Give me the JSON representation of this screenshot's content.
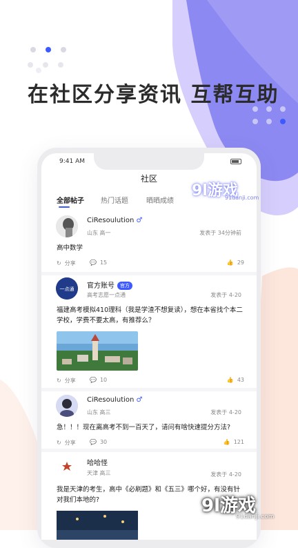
{
  "colors": {
    "accent": "#3d5afe",
    "blob_purple": "#8c89f2",
    "blob_lavender": "#cfc6fb",
    "blob_peach": "#fde6db"
  },
  "headline": "在社区分享资讯 互帮互助",
  "phone": {
    "status_time": "9:41 AM",
    "title": "社区",
    "tabs": [
      "全部帖子",
      "热门话题",
      "晒晒成绩"
    ],
    "posts": [
      {
        "name": "CiResoulution",
        "gender_icon": "male-icon",
        "meta": "山东 高一",
        "time": "发表于 34分钟前",
        "content": "高中数学",
        "share": "分享",
        "comments": "15",
        "likes": "29"
      },
      {
        "name": "官方账号",
        "badge": "官方",
        "avatar_text": "一点通",
        "meta": "高考志愿一点通",
        "time": "发表于 4-20",
        "content": "福建高考模拟410理科（我是学渣不想复读），想在本省找个本二学校，学费不要太高，有推荐么？",
        "share": "分享",
        "comments": "10",
        "likes": "43"
      },
      {
        "name": "CiResoulution",
        "gender_icon": "male-icon",
        "meta": "山东 高三",
        "time": "发表于 4-20",
        "content": "急！！！现在离高考不到一百天了，请问有啥快速提分方法?",
        "share": "分享",
        "comments": "30",
        "likes": "121"
      },
      {
        "name": "哈哈怪",
        "meta": "天津 高三",
        "time": "发表于 4-20",
        "content": "我是天津的考生，高中《必刷题》和《五三》哪个好，有没有针对我们本地的?"
      }
    ]
  },
  "watermark_top": {
    "logo": "9l游戏",
    "url": "91danji.com"
  },
  "watermark_bottom": {
    "logo": "9l游戏",
    "url": "91danji.com"
  }
}
